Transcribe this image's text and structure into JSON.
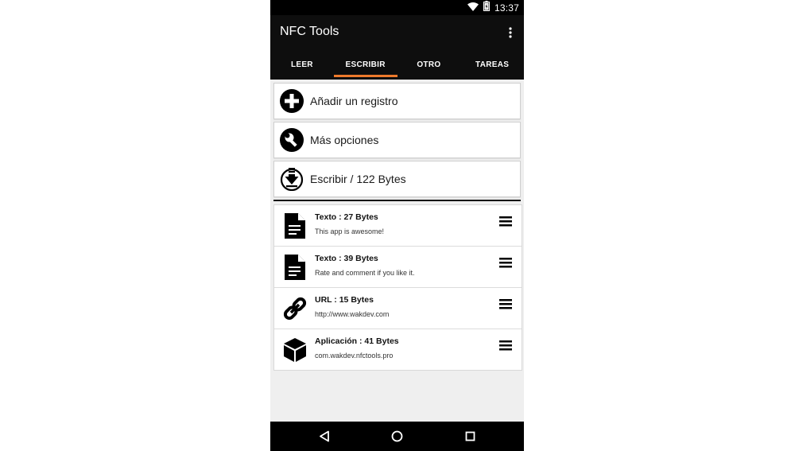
{
  "status_bar": {
    "time": "13:37",
    "icons": [
      "wifi-icon",
      "battery-icon"
    ]
  },
  "app_bar": {
    "title": "NFC Tools",
    "menu_icon": "more-vert-icon"
  },
  "tabs": [
    {
      "label": "LEER",
      "active": false
    },
    {
      "label": "ESCRIBIR",
      "active": true
    },
    {
      "label": "OTRO",
      "active": false
    },
    {
      "label": "TAREAS",
      "active": false
    }
  ],
  "actions": [
    {
      "label": "Añadir un registro",
      "icon": "add-circle-icon"
    },
    {
      "label": "Más opciones",
      "icon": "wrench-icon"
    },
    {
      "label": "Escribir / 122 Bytes",
      "icon": "write-download-icon"
    }
  ],
  "records": [
    {
      "title": "Texto : 27 Bytes",
      "subtitle": "This app is awesome!",
      "icon": "document-icon"
    },
    {
      "title": "Texto : 39 Bytes",
      "subtitle": "Rate and comment if you like it.",
      "icon": "document-icon"
    },
    {
      "title": "URL : 15 Bytes",
      "subtitle": "http://www.wakdev.com",
      "icon": "link-icon"
    },
    {
      "title": "Aplicación : 41 Bytes",
      "subtitle": "com.wakdev.nfctools.pro",
      "icon": "package-icon"
    }
  ],
  "nav_bar": {
    "buttons": [
      "back-icon",
      "home-icon",
      "recents-icon"
    ]
  },
  "colors": {
    "accent": "#ee7a2c",
    "app_bar": "#0e0e0e",
    "background": "#efefef"
  }
}
